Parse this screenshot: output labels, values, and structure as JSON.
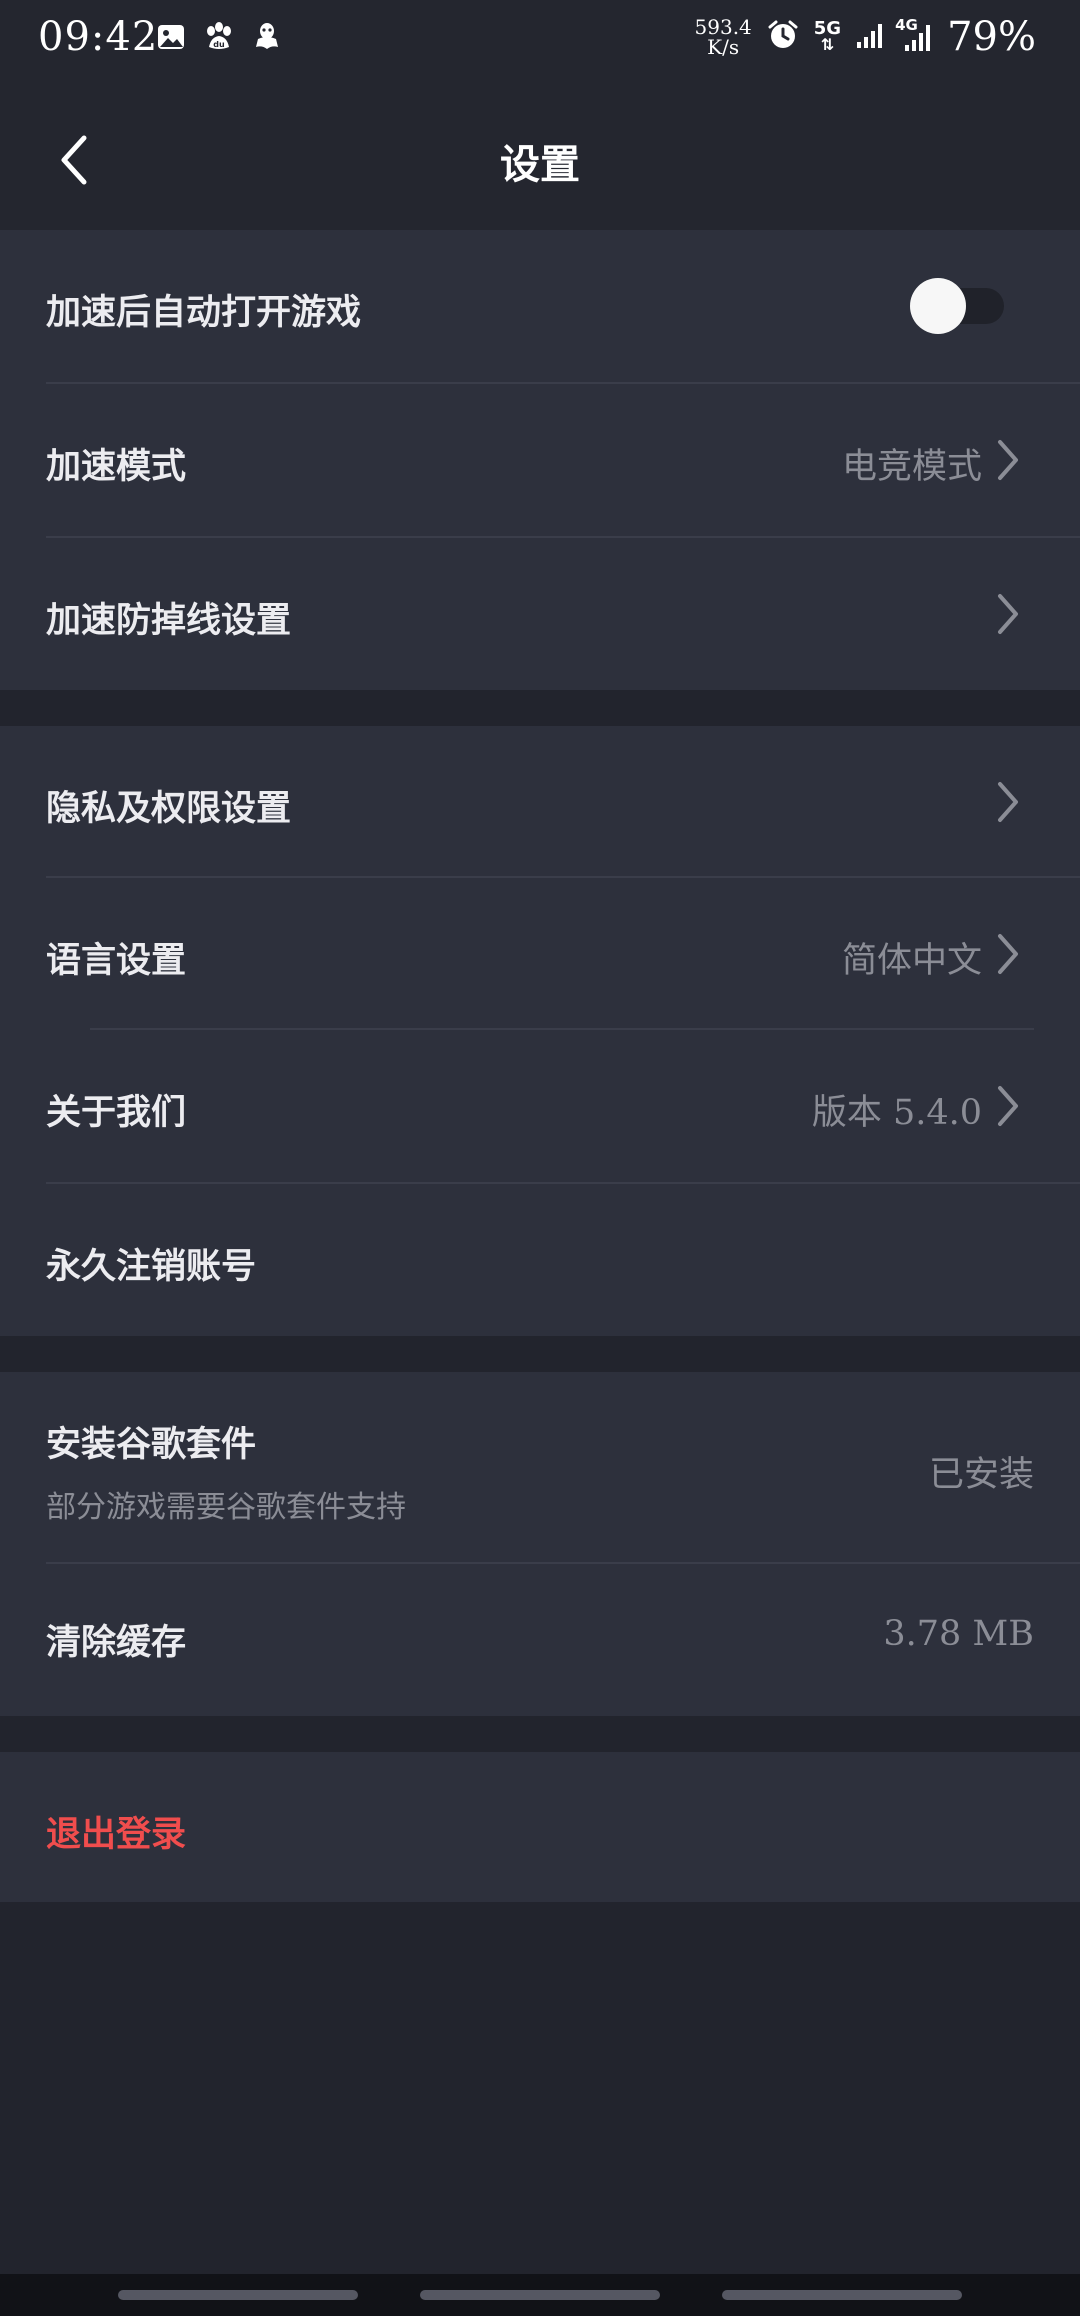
{
  "status_bar": {
    "time": "09:42",
    "net_speed_value": "593.4",
    "net_speed_unit": "K/s",
    "network_5g": "5G",
    "network_4g": "4G",
    "battery": "79%"
  },
  "header": {
    "title": "设置"
  },
  "section1": {
    "auto_open": {
      "label": "加速后自动打开游戏",
      "enabled": false
    },
    "accel_mode": {
      "label": "加速模式",
      "value": "电竞模式"
    },
    "anti_drop": {
      "label": "加速防掉线设置"
    }
  },
  "section2": {
    "privacy": {
      "label": "隐私及权限设置"
    },
    "language": {
      "label": "语言设置",
      "value": "简体中文"
    },
    "about": {
      "label": "关于我们",
      "value": "版本 5.4.0"
    },
    "delete_account": {
      "label": "永久注销账号"
    }
  },
  "section3": {
    "google": {
      "label": "安装谷歌套件",
      "sublabel": "部分游戏需要谷歌套件支持",
      "value": "已安装"
    },
    "cache": {
      "label": "清除缓存",
      "value": "3.78 MB"
    }
  },
  "section4": {
    "logout": {
      "label": "退出登录"
    }
  },
  "colors": {
    "background": "#22242d",
    "card": "#2d303c",
    "accent_red": "#f04d4d",
    "secondary_text": "#8b8d96"
  }
}
